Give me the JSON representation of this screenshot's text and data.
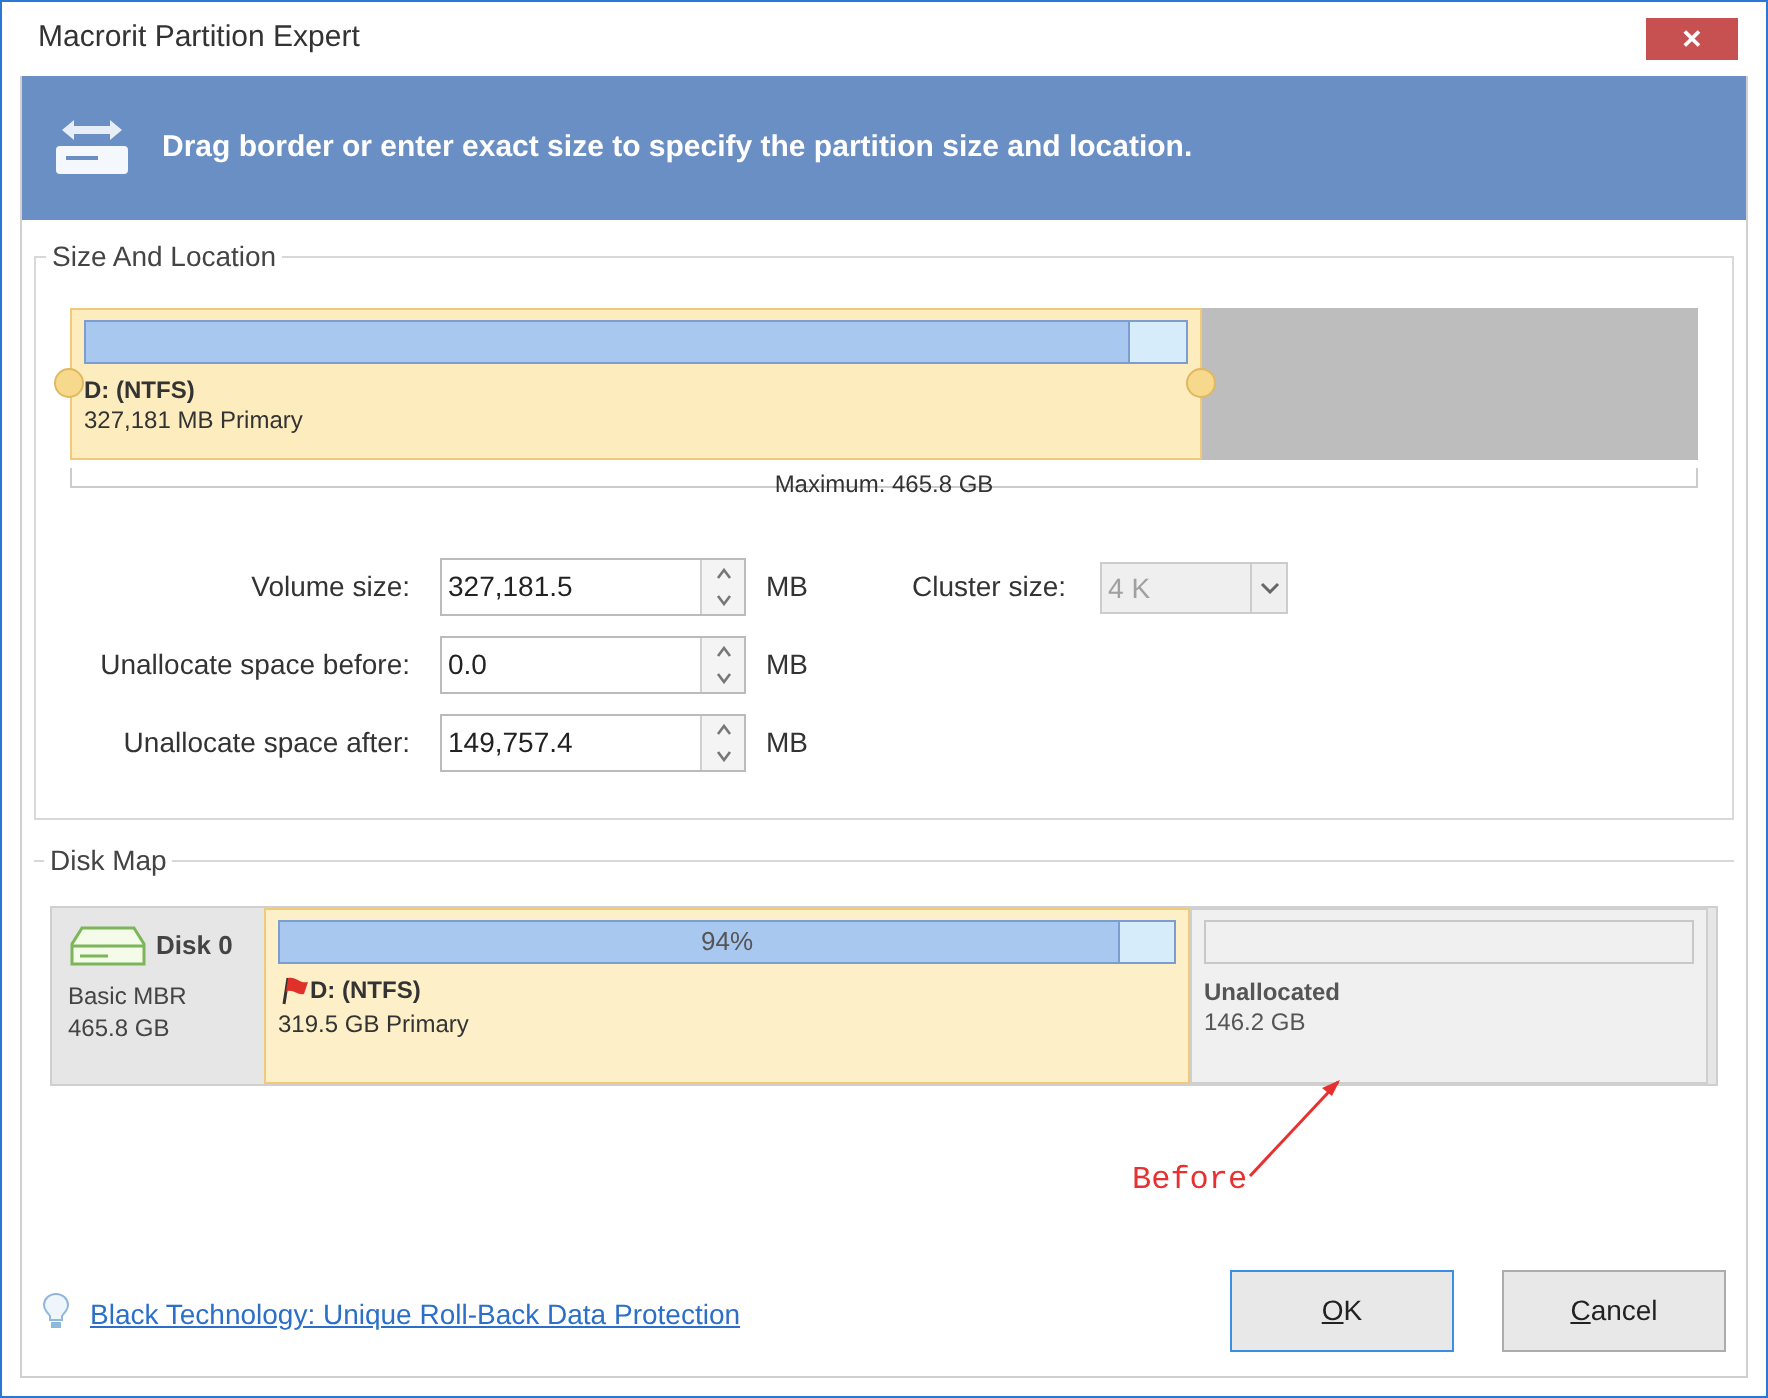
{
  "window": {
    "title": "Macrorit Partition Expert",
    "close": "✕"
  },
  "banner": {
    "text": "Drag border or enter exact size to specify the partition size and location."
  },
  "size_and_location": {
    "title": "Size And Location",
    "partition": {
      "name": "D: (NTFS)",
      "detail": "327,181 MB Primary",
      "level": 0.695,
      "usage": {
        "level": 0.95
      }
    },
    "maximum": "Maximum: 465.8 GB",
    "fields": [
      {
        "label": "Volume size:",
        "value": "327,181.5",
        "unit": "MB"
      },
      {
        "label": "Unallocate space before:",
        "value": "0.0",
        "unit": "MB"
      },
      {
        "label": "Unallocate space after:",
        "value": "149,757.4",
        "unit": "MB"
      }
    ],
    "cluster": {
      "label": "Cluster size:",
      "value": "4 K",
      "disabled": true
    }
  },
  "disk_map": {
    "title": "Disk Map",
    "disk": {
      "name": "Disk 0",
      "type": "Basic MBR",
      "size": "465.8 GB"
    },
    "partitions": [
      {
        "kind": "partition",
        "name": "D: (NTFS)",
        "detail": "319.5 GB Primary",
        "percent": "94%",
        "level": 0.94,
        "selected": true
      },
      {
        "kind": "unallocated",
        "name": "Unallocated",
        "detail": "146.2 GB",
        "selected": false
      }
    ]
  },
  "annotation": "Before",
  "link": "Black Technology: Unique Roll-Back Data Protection",
  "buttons": [
    {
      "label": "OK",
      "focused": true
    },
    {
      "label": "Cancel",
      "focused": false
    }
  ]
}
